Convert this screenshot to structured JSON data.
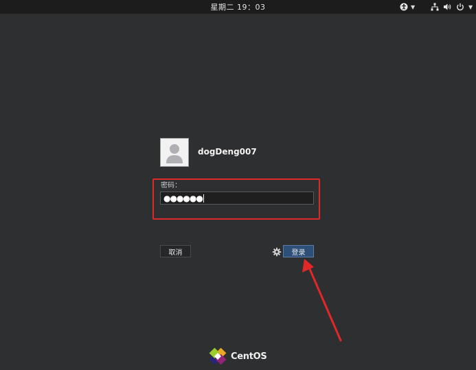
{
  "topbar": {
    "clock": "星期二 19：03",
    "accessibility_icon": "accessibility-icon",
    "network_icon": "network-icon",
    "volume_icon": "volume-icon",
    "power_icon": "power-icon"
  },
  "login": {
    "username": "dogDeng007",
    "password_label": "密码：",
    "password_value": "●●●●●●",
    "cancel_label": "取消",
    "login_label": "登录",
    "settings_icon": "gear-icon"
  },
  "brand": {
    "name": "CentOS"
  },
  "colors": {
    "background": "#2e2f31",
    "topbar": "#1c1c1d",
    "login_button": "#2d4f78",
    "annotation": "#e0282a"
  }
}
